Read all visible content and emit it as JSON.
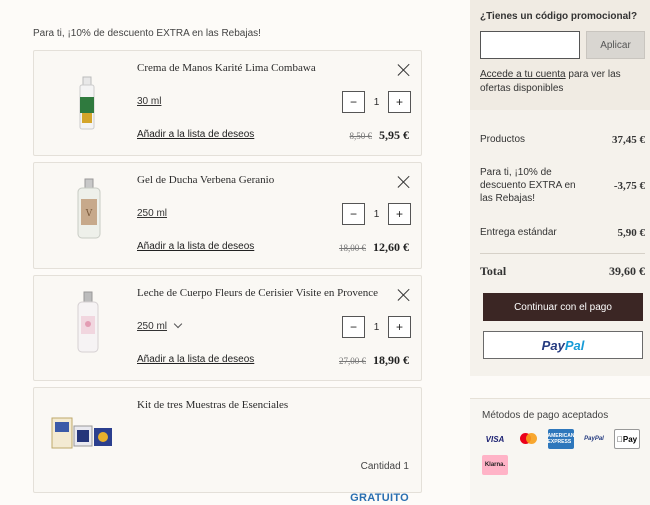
{
  "promo_banner": "Para ti, ¡10% de descuento EXTRA en las Rebajas!",
  "cart_items": [
    {
      "name": "Crema de Manos Karité Lima Combawa",
      "size": "30 ml",
      "qty": "1",
      "wishlist": "Añadir a la lista de deseos",
      "old_price": "8,50 €",
      "new_price": "5,95 €"
    },
    {
      "name": "Gel de Ducha Verbena Geranio",
      "size": "250 ml",
      "qty": "1",
      "wishlist": "Añadir a la lista de deseos",
      "old_price": "18,00 €",
      "new_price": "12,60 €"
    },
    {
      "name": "Leche de Cuerpo Fleurs de Cerisier Visite en Provence",
      "size": "250 ml",
      "qty": "1",
      "wishlist": "Añadir a la lista de deseos",
      "old_price": "27,00 €",
      "new_price": "18,90 €"
    }
  ],
  "kit": {
    "name": "Kit de tres Muestras de Esenciales",
    "qty_label": "Cantidad 1",
    "price": "GRATUITO"
  },
  "qty_minus": "−",
  "qty_plus": "+",
  "promo": {
    "question": "¿Tienes un código promocional?",
    "input_value": "",
    "apply_label": "Aplicar",
    "login_link": "Accede a tu cuenta",
    "login_rest": " para ver las ofertas disponibles"
  },
  "summary": {
    "products_label": "Productos",
    "products_value": "37,45 €",
    "discount_label": "Para ti, ¡10% de descuento EXTRA en las Rebajas!",
    "discount_value": "-3,75 €",
    "shipping_label": "Entrega estándar",
    "shipping_value": "5,90 €",
    "total_label": "Total",
    "total_value": "39,60 €",
    "continue_label": "Continuar con el pago",
    "paypal_p1": "Pay",
    "paypal_p2": "Pal"
  },
  "payment": {
    "title": "Métodos de pago aceptados",
    "methods": [
      "VISA",
      "Mastercard",
      "AMERICAN EXPRESS",
      "PayPal",
      "Pay",
      "Klarna."
    ]
  },
  "colors": {
    "accent_button": "#3b2624",
    "free_text": "#2a6fb1",
    "panel_bg": "#f0ebe3"
  }
}
